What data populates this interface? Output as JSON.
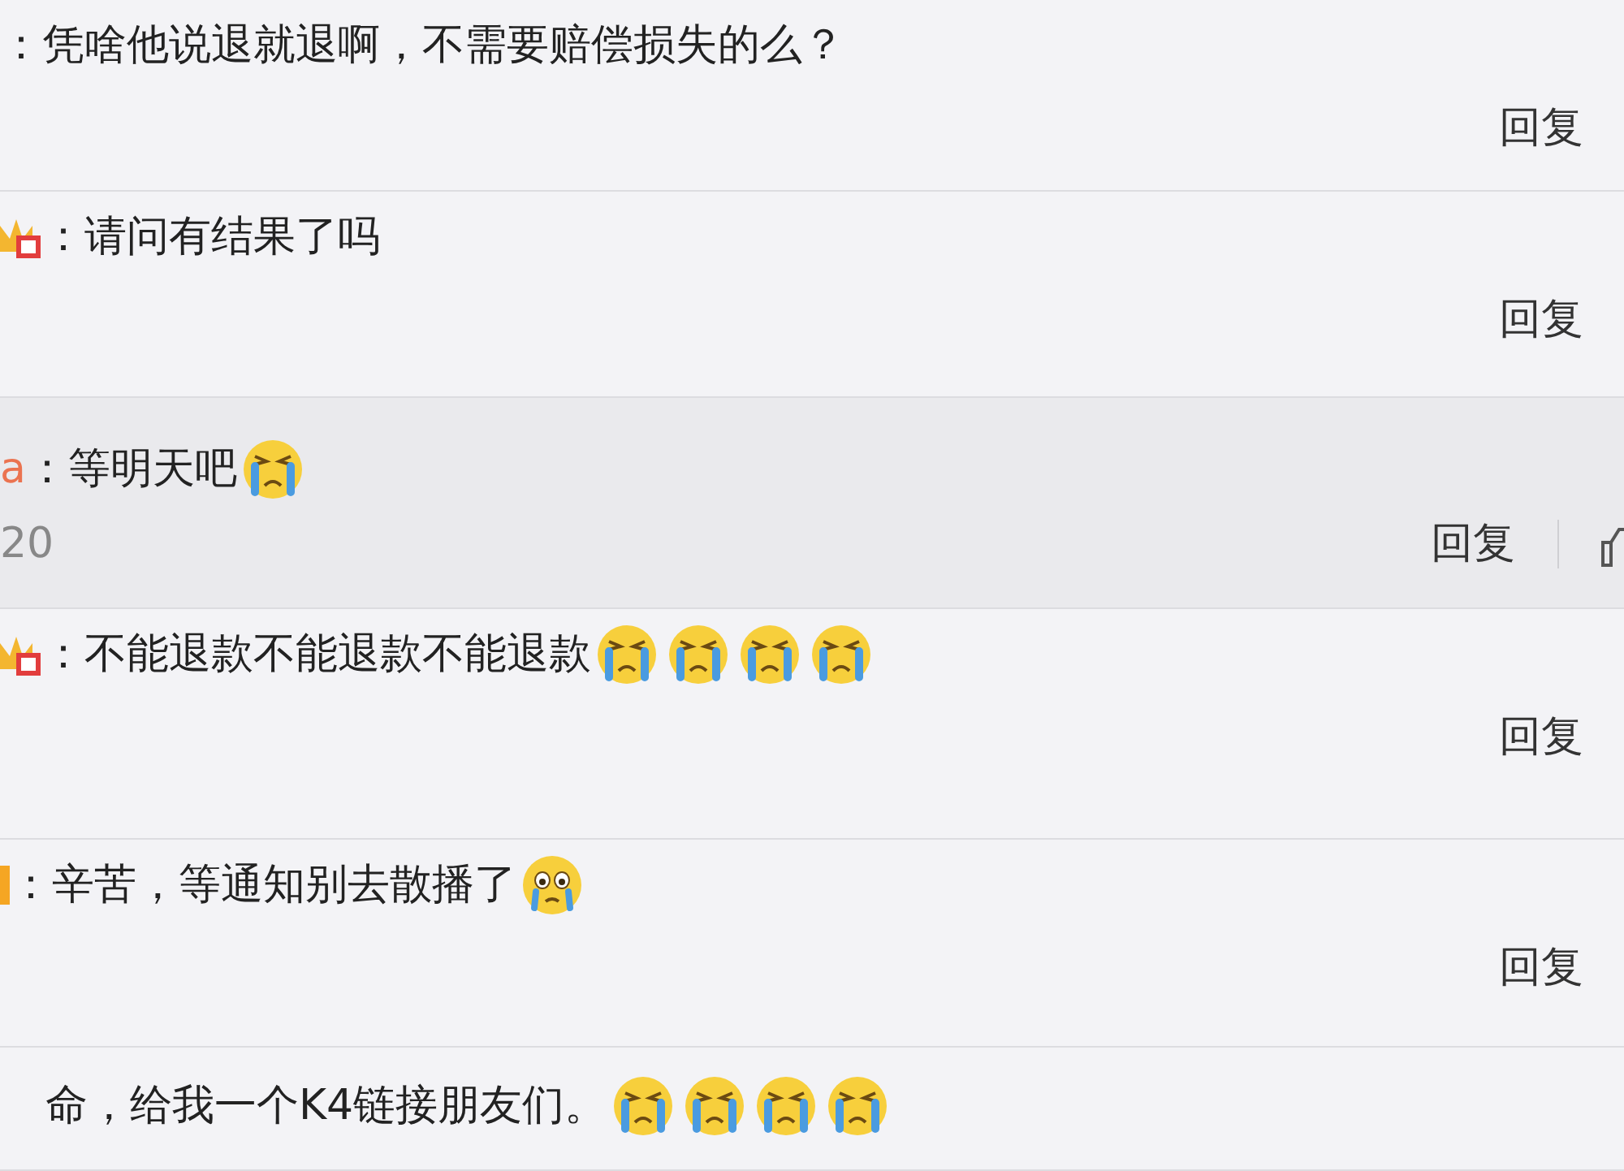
{
  "comments": [
    {
      "kind": "comment",
      "text": "：凭啥他说退就退啊，不需要赔偿损失的么？",
      "reply_label": "回复"
    },
    {
      "kind": "comment",
      "badge": {
        "kind": "crown"
      },
      "text": "：请问有结果了吗",
      "reply_label": "回复"
    },
    {
      "kind": "reply",
      "user": "a",
      "text": "：等明天吧",
      "emojis": [
        {
          "kind": "cry"
        }
      ],
      "time": "20",
      "reply_label": "回复"
    },
    {
      "kind": "comment",
      "badge": {
        "kind": "crown"
      },
      "text": "：不能退款不能退款不能退款",
      "emojis": [
        {
          "kind": "cry"
        },
        {
          "kind": "cry"
        },
        {
          "kind": "cry"
        },
        {
          "kind": "cry"
        }
      ],
      "reply_label": "回复"
    },
    {
      "kind": "comment",
      "badge": {
        "kind": "bar"
      },
      "text": "：辛苦，等通知别去散播了",
      "emojis": [
        {
          "kind": "tear"
        }
      ],
      "reply_label": "回复"
    },
    {
      "kind": "comment",
      "text": "命，给我一个K4链接朋友们。",
      "emojis": [
        {
          "kind": "cry"
        },
        {
          "kind": "cry"
        },
        {
          "kind": "cry"
        },
        {
          "kind": "cry"
        }
      ]
    }
  ]
}
